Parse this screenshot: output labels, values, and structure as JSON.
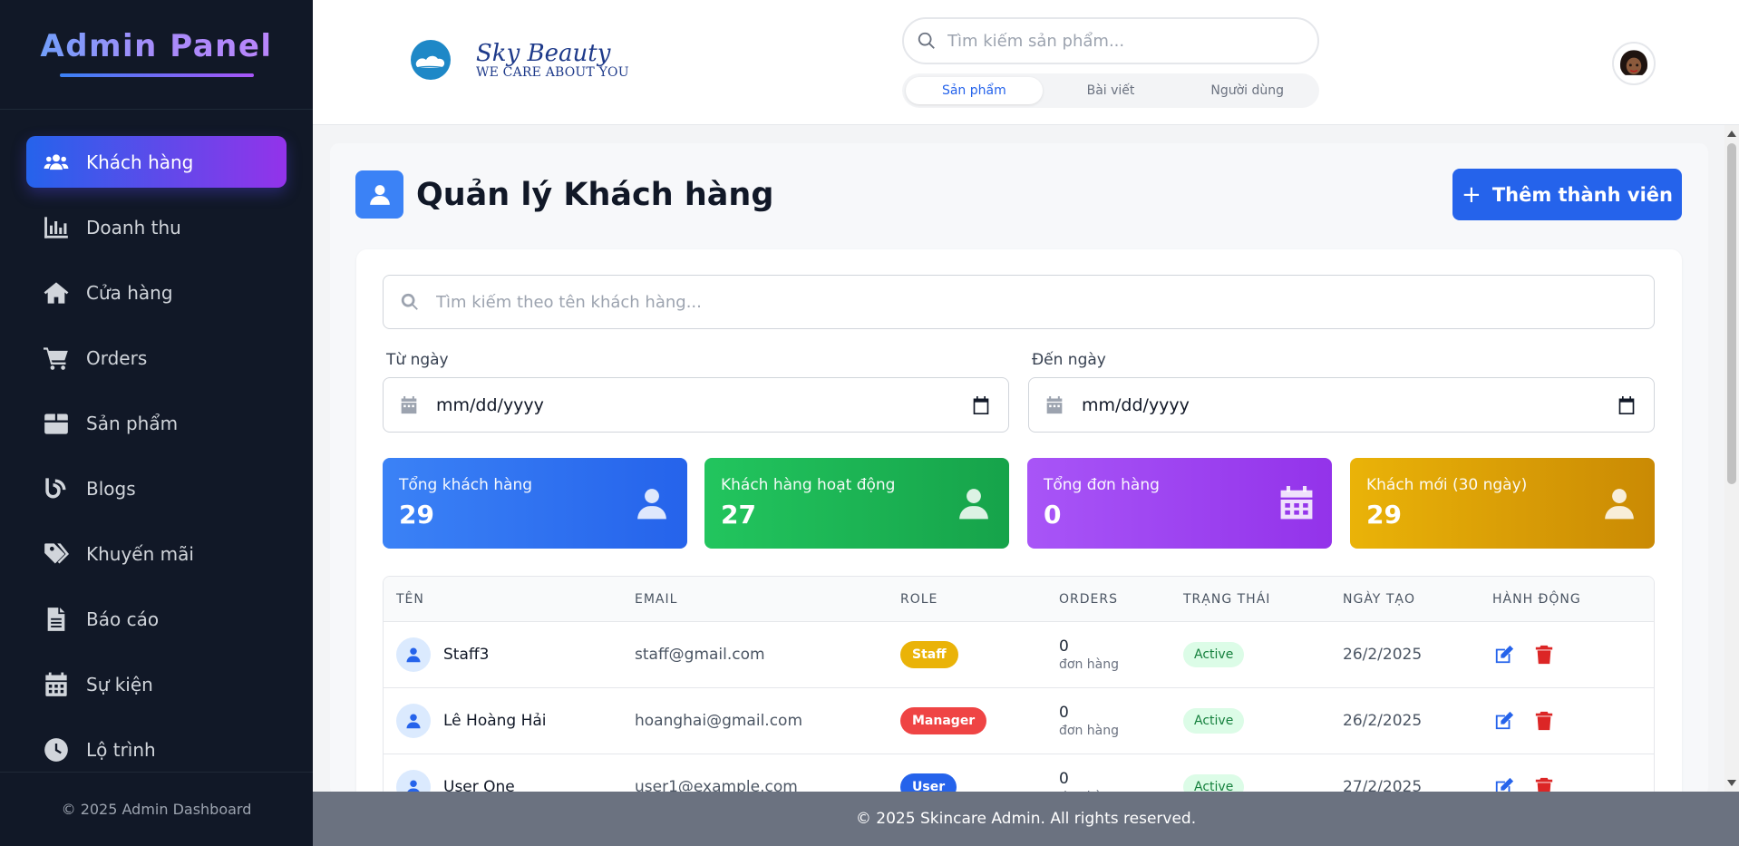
{
  "sidebar": {
    "title": "Admin Panel",
    "items": [
      {
        "label": "Khách hàng",
        "icon": "users-icon",
        "active": true
      },
      {
        "label": "Doanh thu",
        "icon": "chart-bar-icon"
      },
      {
        "label": "Cửa hàng",
        "icon": "home-icon"
      },
      {
        "label": "Orders",
        "icon": "cart-icon"
      },
      {
        "label": "Sản phẩm",
        "icon": "box-icon"
      },
      {
        "label": "Blogs",
        "icon": "blog-icon"
      },
      {
        "label": "Khuyến mãi",
        "icon": "tags-icon"
      },
      {
        "label": "Báo cáo",
        "icon": "file-icon"
      },
      {
        "label": "Sự kiện",
        "icon": "calendar-icon"
      },
      {
        "label": "Lộ trình",
        "icon": "clock-icon"
      }
    ],
    "footer": "© 2025 Admin Dashboard"
  },
  "header": {
    "logo_line1": "Sky Beauty",
    "logo_line2": "WE CARE ABOUT YOU",
    "search_placeholder": "Tìm kiếm sản phẩm...",
    "tabs": [
      {
        "label": "Sản phẩm",
        "active": true
      },
      {
        "label": "Bài viết"
      },
      {
        "label": "Người dùng"
      }
    ]
  },
  "main": {
    "title": "Quản lý Khách hàng",
    "add_button": "Thêm thành viên",
    "search_placeholder": "Tìm kiếm theo tên khách hàng...",
    "from_label": "Từ ngày",
    "to_label": "Đến ngày",
    "date_placeholder": "mm/dd/yyyy",
    "stats": [
      {
        "label": "Tổng khách hàng",
        "value": "29",
        "icon": "user-icon",
        "color_from": "#3b82f6",
        "color_to": "#2563eb"
      },
      {
        "label": "Khách hàng hoạt động",
        "value": "27",
        "icon": "user-icon",
        "color_from": "#22c55e",
        "color_to": "#16a34a"
      },
      {
        "label": "Tổng đơn hàng",
        "value": "0",
        "icon": "calendar-icon",
        "color_from": "#a855f7",
        "color_to": "#9333ea"
      },
      {
        "label": "Khách mới (30 ngày)",
        "value": "29",
        "icon": "user-icon",
        "color_from": "#eab308",
        "color_to": "#ca8a04"
      }
    ],
    "table": {
      "headers": [
        "TÊN",
        "EMAIL",
        "ROLE",
        "ORDERS",
        "TRẠNG THÁI",
        "NGÀY TẠO",
        "HÀNH ĐỘNG"
      ],
      "orders_unit": "đơn hàng",
      "rows": [
        {
          "name": "Staff3",
          "email": "staff@gmail.com",
          "role": "Staff",
          "role_color": "#eab308",
          "orders": "0",
          "status": "Active",
          "created": "26/2/2025"
        },
        {
          "name": "Lê Hoàng Hải",
          "email": "hoanghai@gmail.com",
          "role": "Manager",
          "role_color": "#ef4444",
          "orders": "0",
          "status": "Active",
          "created": "26/2/2025"
        },
        {
          "name": "User One",
          "email": "user1@example.com",
          "role": "User",
          "role_color": "#2563eb",
          "orders": "0",
          "status": "Active",
          "created": "27/2/2025"
        }
      ]
    }
  },
  "footer": "© 2025 Skincare Admin. All rights reserved."
}
